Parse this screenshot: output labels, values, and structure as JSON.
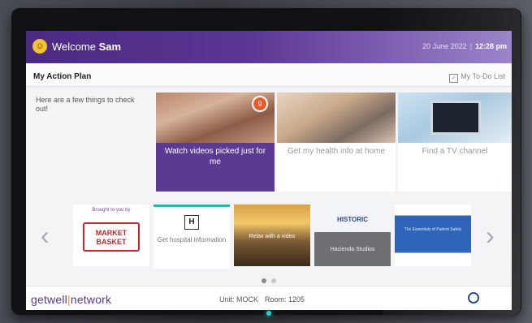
{
  "header": {
    "greeting": "Welcome",
    "user_name": "Sam",
    "date": "20 June 2022",
    "time": "12:28 pm",
    "accent_color": "#5a3592"
  },
  "action_plan": {
    "title": "My Action Plan",
    "todo_label": "My To-Do List",
    "intro": "Here are a few things to check out!",
    "tiles": [
      {
        "label": "Watch videos picked just for me",
        "badge": "9"
      },
      {
        "label": "Get my health info at home"
      },
      {
        "label": "Find a TV channel"
      }
    ]
  },
  "carousel": {
    "cards": [
      {
        "brought": "Brought to you by",
        "logo": "MARKET BASKET"
      },
      {
        "icon": "H",
        "label": "Get hospital information"
      },
      {
        "label": "Relax with a video"
      },
      {
        "logo": "HISTORIC",
        "label": "Hacienda Studios"
      },
      {
        "label": "The Essentials of Patient Safety"
      }
    ]
  },
  "footer": {
    "brand_a": "getwell",
    "brand_sep": "|",
    "brand_b": "network",
    "unit_label": "Unit: MOCK",
    "room_label": "Room: 1205"
  }
}
